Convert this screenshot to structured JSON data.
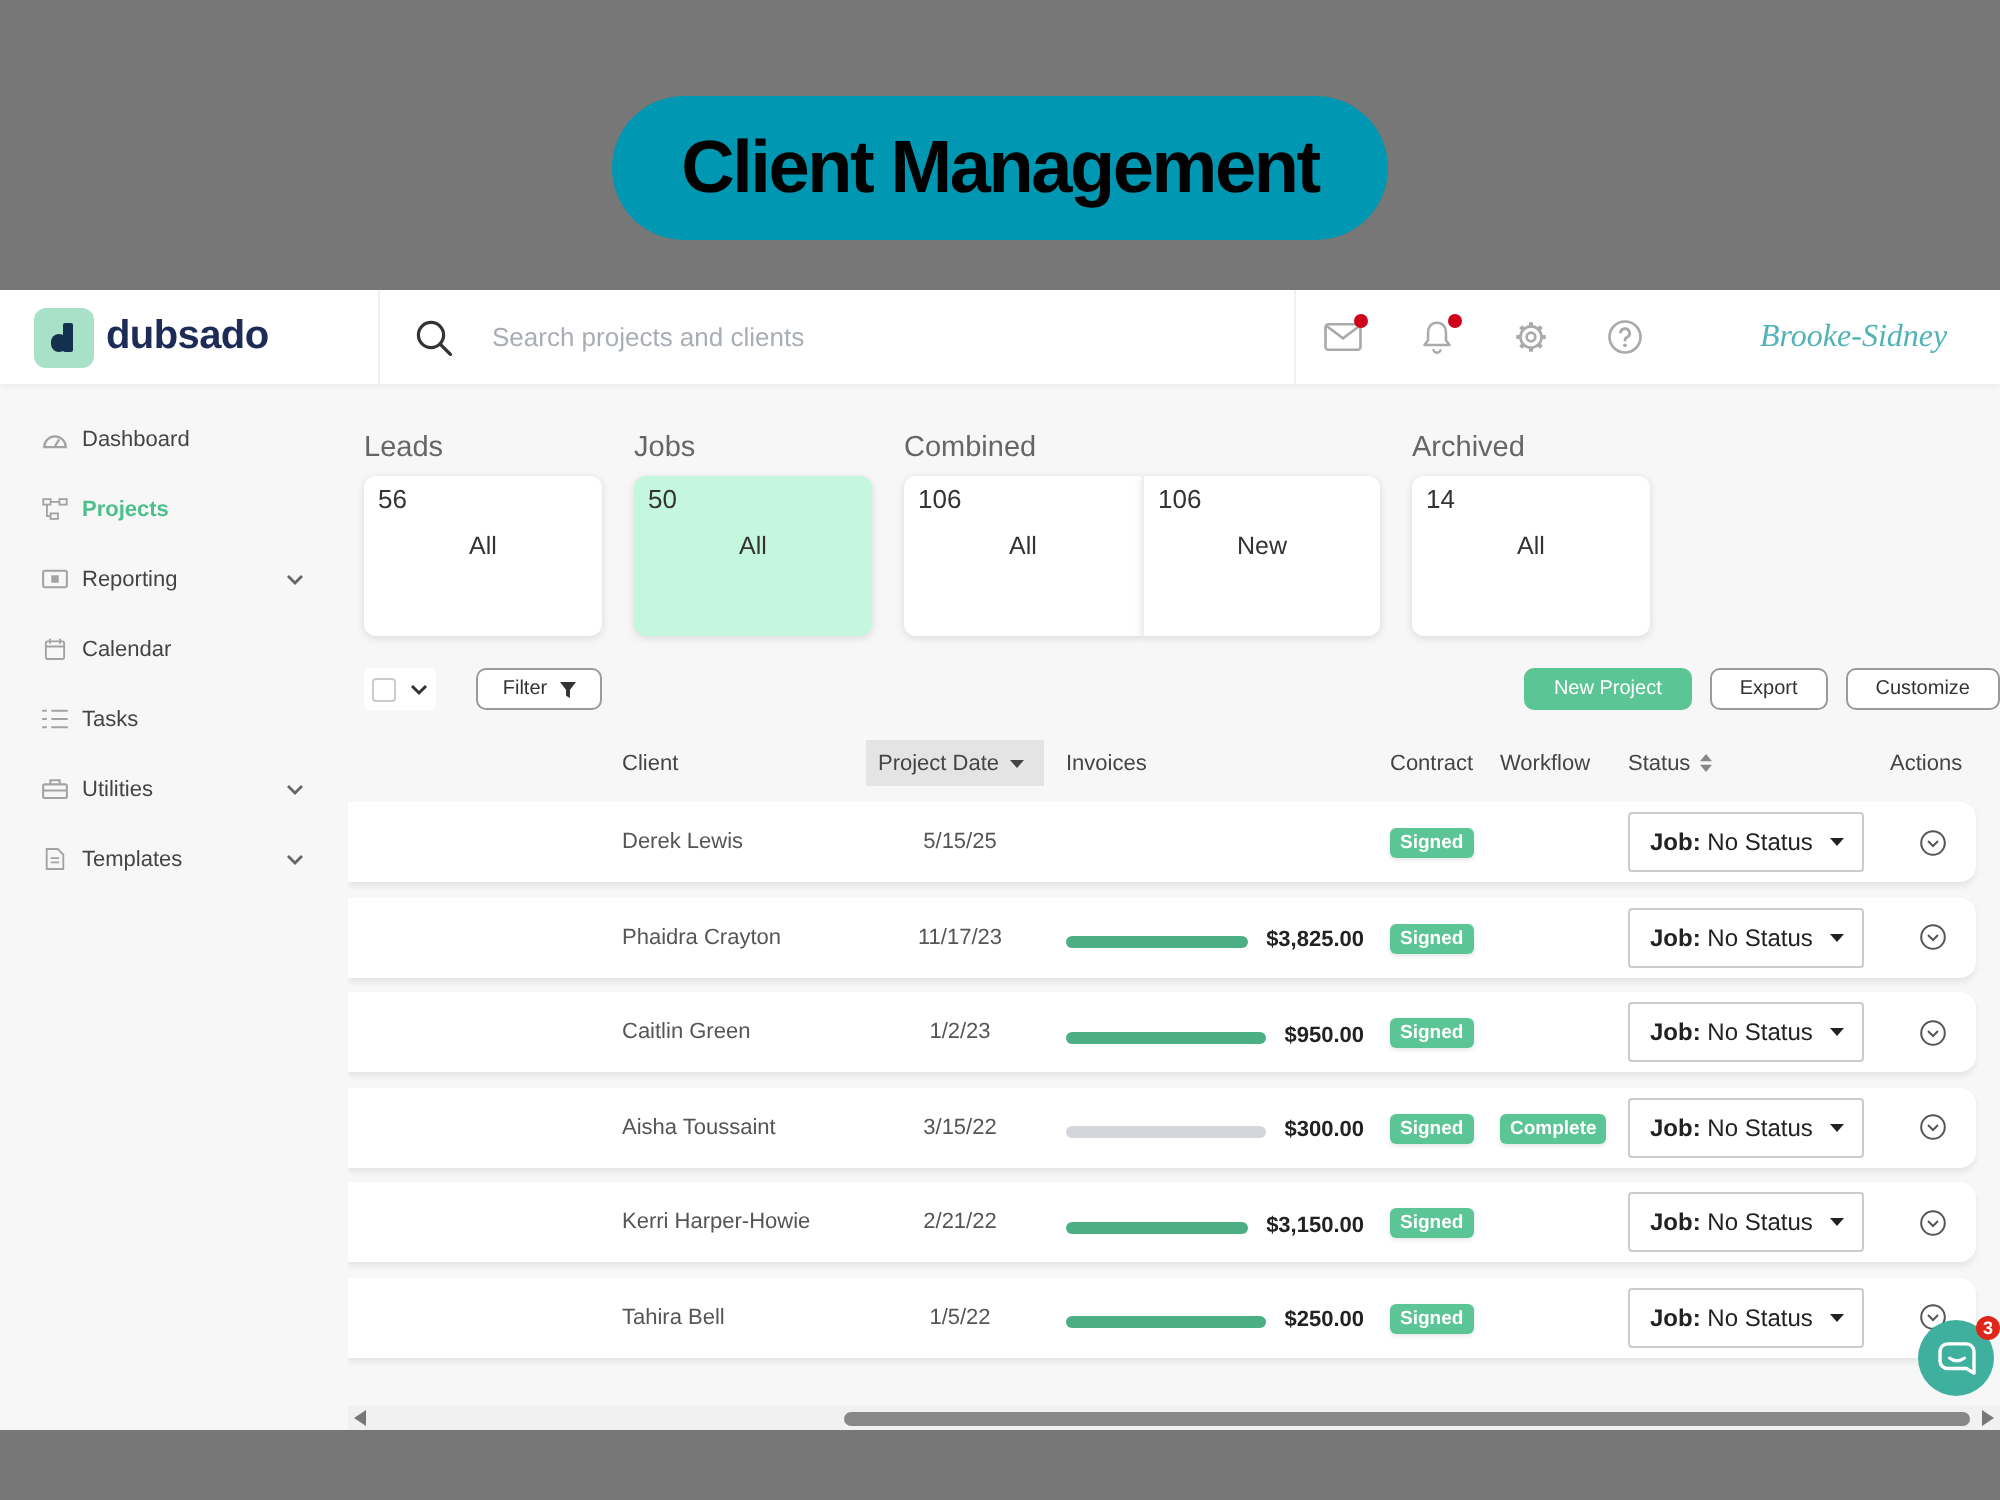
{
  "banner": {
    "title": "Client Management"
  },
  "header": {
    "logo_text": "dubsado",
    "search": {
      "placeholder": "Search projects and clients"
    },
    "icons": [
      {
        "unread": true
      },
      {
        "unread": true
      },
      {
        "unread": false
      },
      {
        "unread": false
      }
    ],
    "signature": "Brooke-Sidney"
  },
  "sidebar": {
    "items": [
      {
        "label": "Dashboard",
        "selected": false,
        "has_submenu": false
      },
      {
        "label": "Projects",
        "selected": true,
        "has_submenu": false
      },
      {
        "label": "Reporting",
        "selected": false,
        "has_submenu": true
      },
      {
        "label": "Calendar",
        "selected": false,
        "has_submenu": false
      },
      {
        "label": "Tasks",
        "selected": false,
        "has_submenu": false
      },
      {
        "label": "Utilities",
        "selected": false,
        "has_submenu": true
      },
      {
        "label": "Templates",
        "selected": false,
        "has_submenu": true
      }
    ]
  },
  "project_groups": [
    {
      "label": "Leads",
      "cards": [
        {
          "count": "56",
          "label": "All",
          "selected": false
        }
      ]
    },
    {
      "label": "Jobs",
      "cards": [
        {
          "count": "50",
          "label": "All",
          "selected": true
        }
      ]
    },
    {
      "label": "Combined",
      "cards": [
        {
          "count": "106",
          "label": "All",
          "selected": false
        },
        {
          "count": "106",
          "label": "New",
          "selected": false
        }
      ]
    },
    {
      "label": "Archived",
      "cards": [
        {
          "count": "14",
          "label": "All",
          "selected": false
        }
      ]
    }
  ],
  "toolbar": {
    "select_all": {
      "checked": false
    },
    "filter": {
      "label": "Filter"
    },
    "buttons": [
      {
        "label": "New Project",
        "kind": "primary"
      },
      {
        "label": "Export",
        "kind": "outline"
      },
      {
        "label": "Customize",
        "kind": "outline"
      }
    ]
  },
  "table": {
    "columns": [
      {
        "label": "Client",
        "kind": "plain"
      },
      {
        "label": "Project Date",
        "kind": "sorted"
      },
      {
        "label": "Invoices",
        "kind": "plain"
      },
      {
        "label": "Contract",
        "kind": "plain"
      },
      {
        "label": "Workflow",
        "kind": "plain"
      },
      {
        "label": "Status",
        "kind": "sortable"
      },
      {
        "label": "Actions",
        "kind": "plain"
      }
    ],
    "rows": [
      {
        "client": "Derek Lewis",
        "date": "5/15/25",
        "contract": "Signed",
        "status": "**Job:** No Status"
      },
      {
        "client": "Phaidra Crayton",
        "date": "11/17/23",
        "invoice": {
          "amount": "$3,825.00",
          "paid": true
        },
        "contract": "Signed",
        "status": "**Job:** No Status"
      },
      {
        "client": "Caitlin Green",
        "date": "1/2/23",
        "invoice": {
          "amount": "$950.00",
          "paid": true
        },
        "contract": "Signed",
        "status": "**Job:** No Status"
      },
      {
        "client": "Aisha Toussaint",
        "date": "3/15/22",
        "invoice": {
          "amount": "$300.00",
          "paid": false
        },
        "contract": "Signed",
        "workflow": "Complete",
        "status": "**Job:** No Status"
      },
      {
        "client": "Kerri Harper-Howie",
        "date": "2/21/22",
        "invoice": {
          "amount": "$3,150.00",
          "paid": true
        },
        "contract": "Signed",
        "status": "**Job:** No Status"
      },
      {
        "client": "Tahira Bell",
        "date": "1/5/22",
        "invoice": {
          "amount": "$250.00",
          "paid": true
        },
        "contract": "Signed",
        "status": "**Job:** No Status"
      }
    ]
  },
  "chat": {
    "badge": "3"
  }
}
